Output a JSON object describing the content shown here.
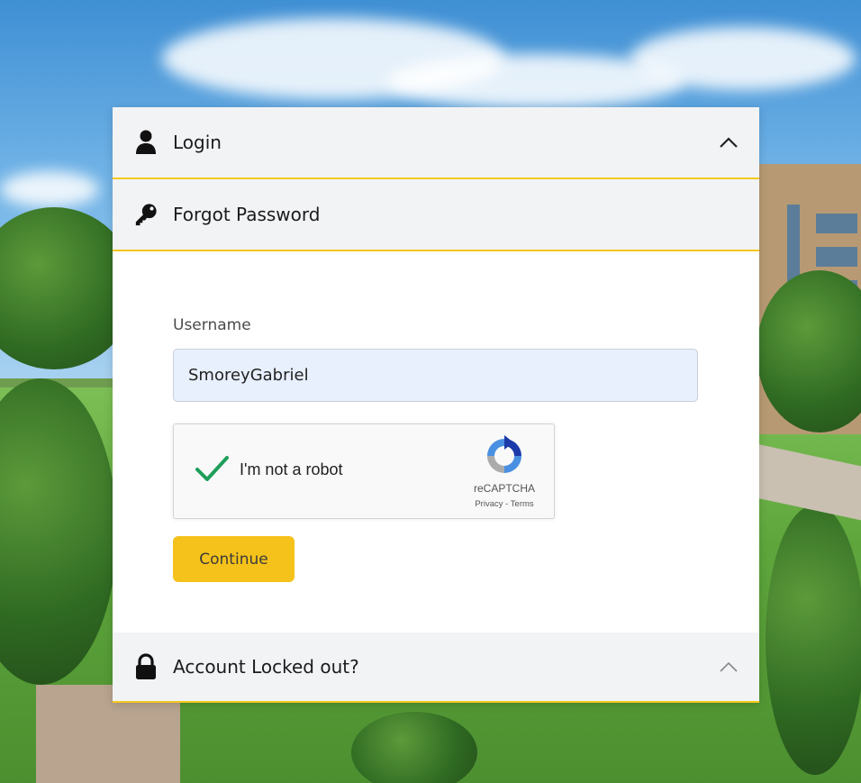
{
  "sections": {
    "login": {
      "title": "Login",
      "icon": "user-icon",
      "expanded": true
    },
    "forgot_password": {
      "title": "Forgot Password",
      "icon": "key-icon"
    },
    "account_locked": {
      "title": "Account Locked out?",
      "icon": "lock-icon"
    }
  },
  "form": {
    "username_label": "Username",
    "username_value": "SmoreyGabriel",
    "continue_label": "Continue"
  },
  "recaptcha": {
    "checkbox_label": "I'm not a robot",
    "checked": true,
    "brand": "reCAPTCHA",
    "privacy_label": "Privacy",
    "separator": " - ",
    "terms_label": "Terms"
  },
  "colors": {
    "accent": "#f4c81c",
    "button": "#f5c21b",
    "header_bg": "#f2f3f5",
    "input_bg": "#e8f0fe",
    "check": "#1e9e5a"
  }
}
